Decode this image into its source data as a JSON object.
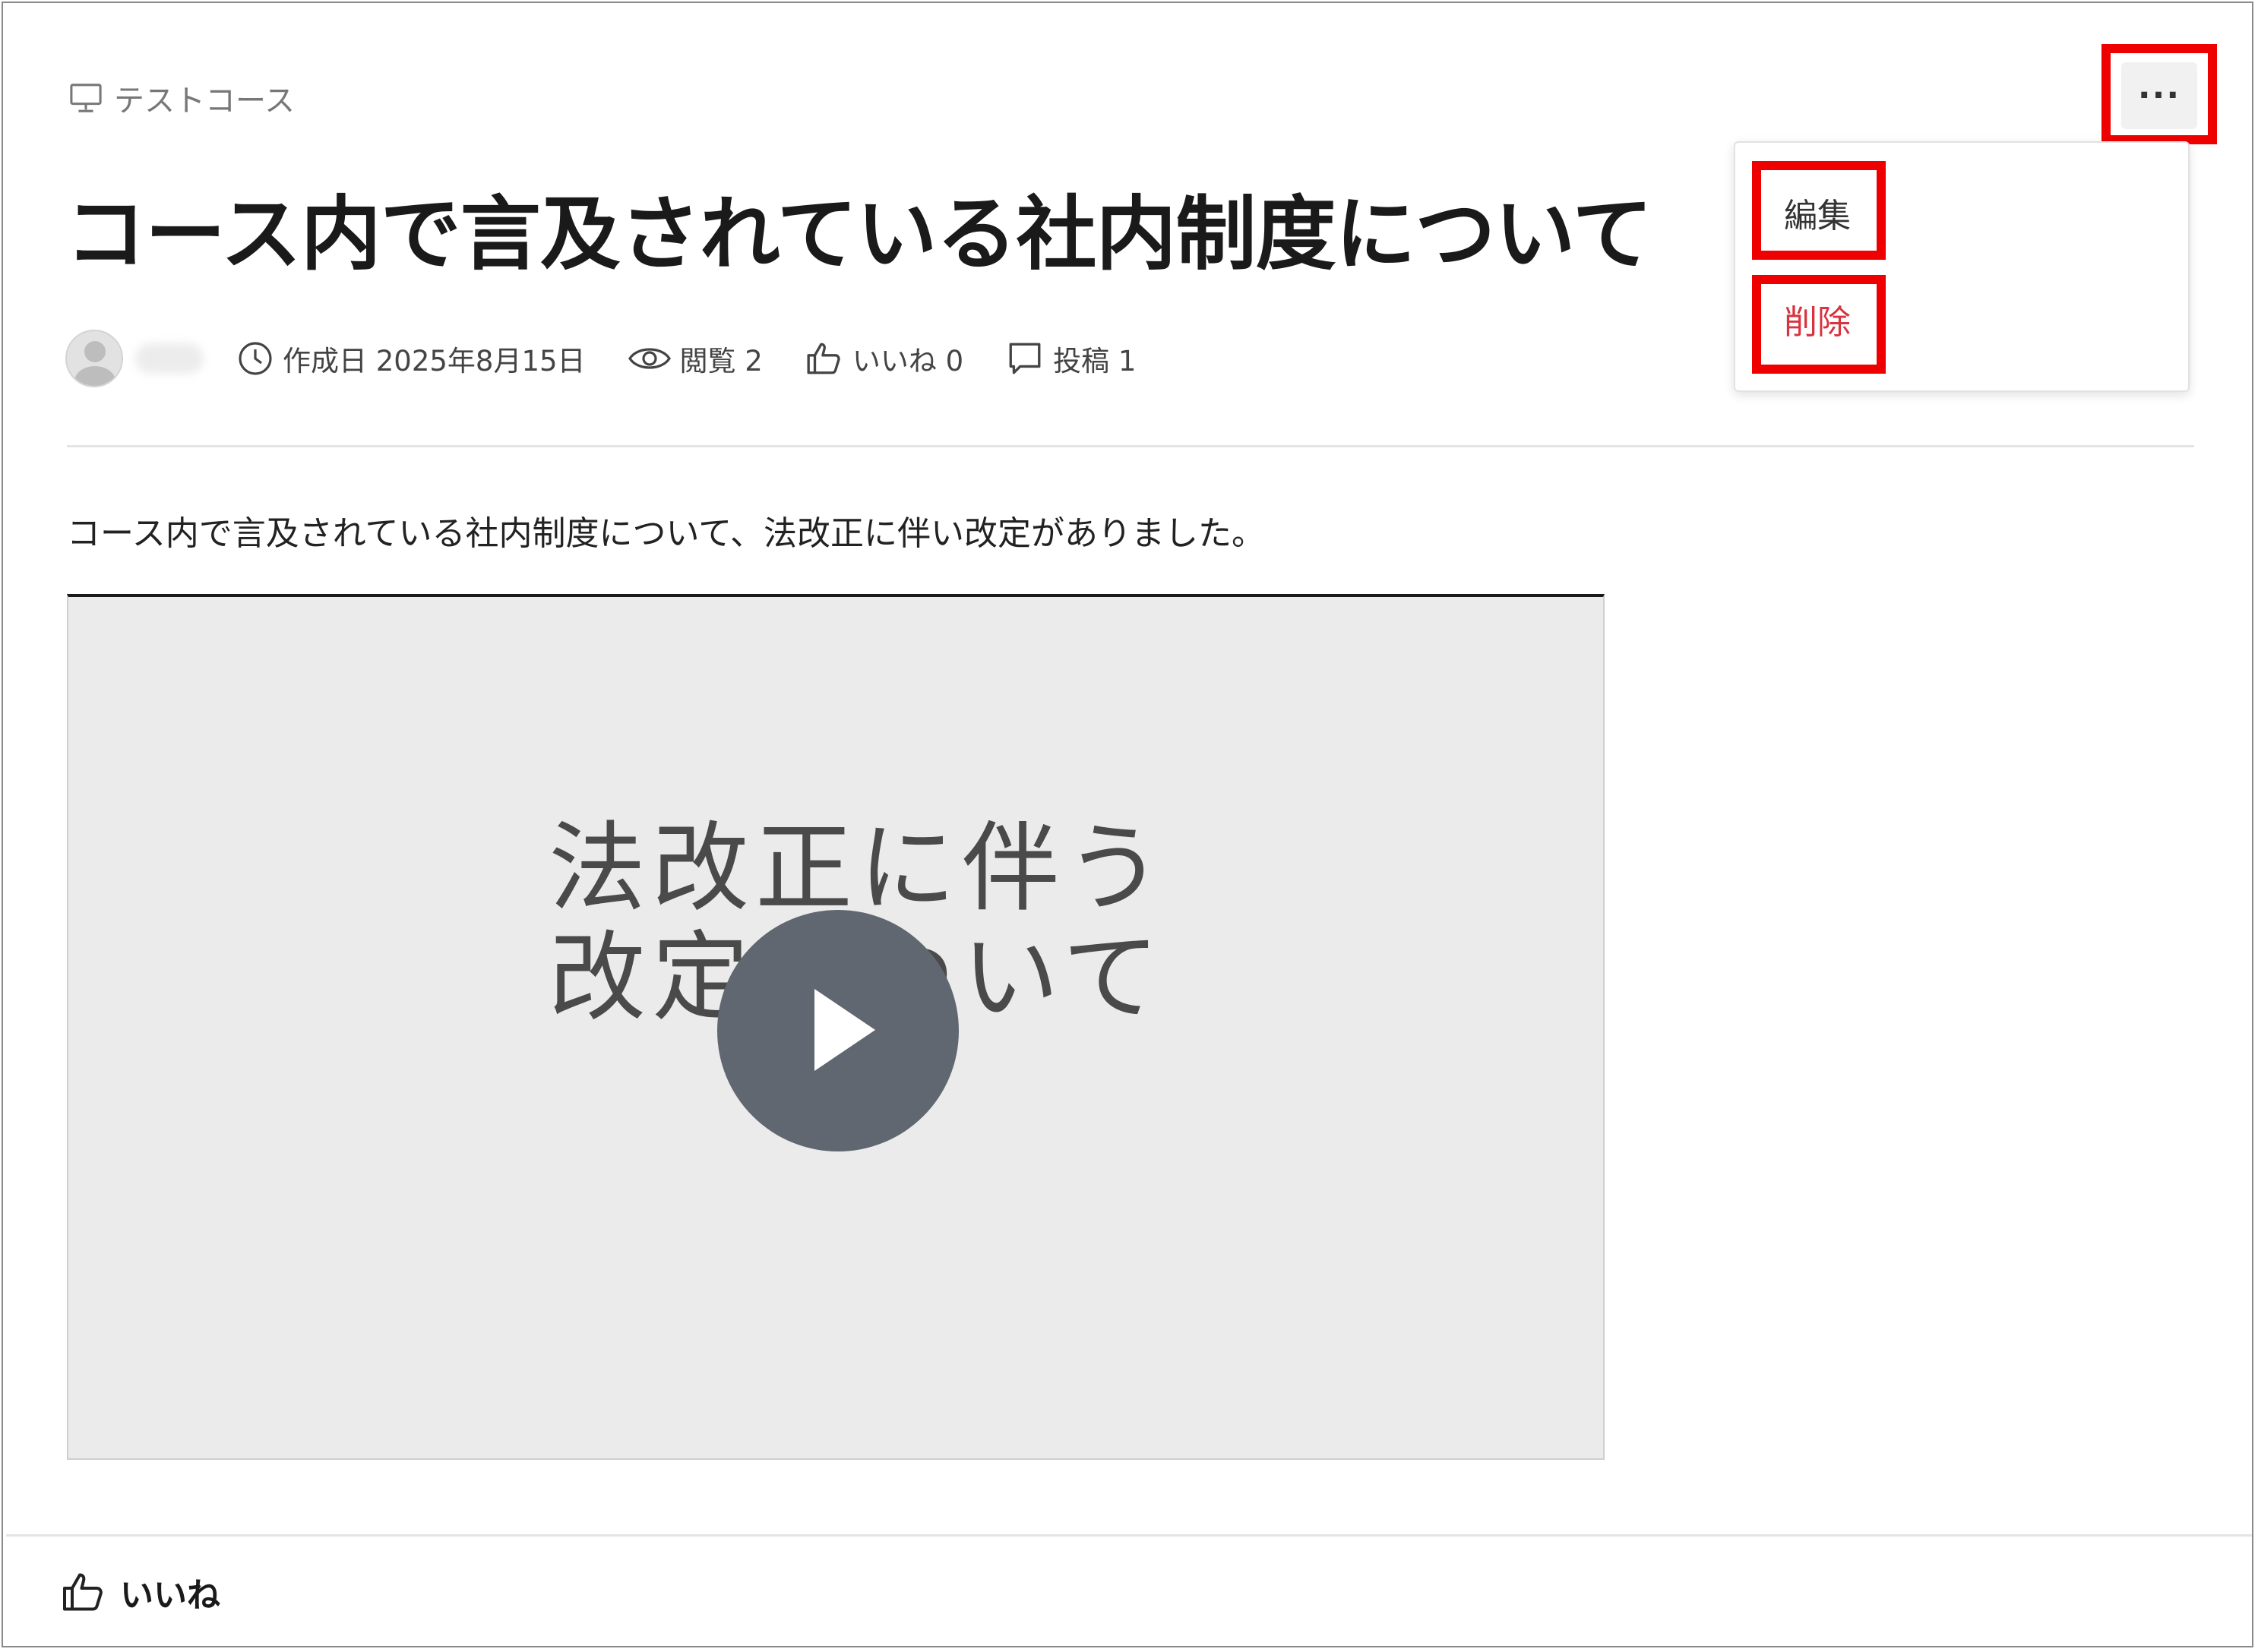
{
  "course": {
    "icon": "monitor-icon",
    "name": "テストコース"
  },
  "post": {
    "title": "コース内で言及されている社内制度について",
    "body": "コース内で言及されている社内制度について、法改正に伴い改定がありました。"
  },
  "meta": {
    "created_label": "作成日 2025年8月15日",
    "views_label": "閲覧 2",
    "likes_label": "いいね 0",
    "posts_label": "投稿 1"
  },
  "video": {
    "slide_line1": "法改正に伴う",
    "slide_line2": "改定について"
  },
  "footer": {
    "like_label": "いいね"
  },
  "menu": {
    "more_label": "···",
    "edit_label": "編集",
    "delete_label": "削除"
  },
  "colors": {
    "highlight": "#ee0000",
    "delete": "#d8333f",
    "play_button": "#606770",
    "video_bg": "#ebebeb"
  }
}
